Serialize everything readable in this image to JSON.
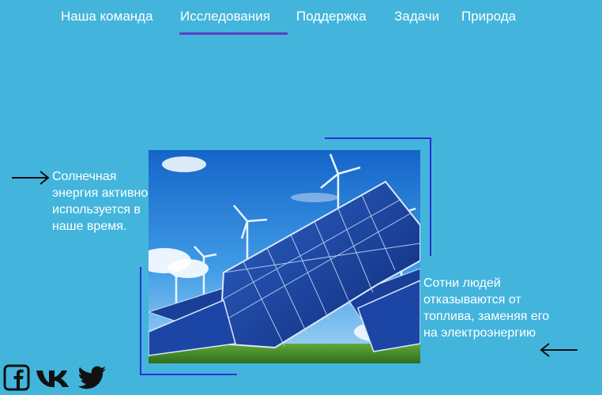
{
  "nav": {
    "items": [
      {
        "label": "Наша команда"
      },
      {
        "label": "Исследования",
        "active": true
      },
      {
        "label": "Поддержка"
      },
      {
        "label": "Задачи"
      },
      {
        "label": "Природа"
      }
    ]
  },
  "captions": {
    "left": "Солнечная энергия активно используется в наше время.",
    "right": "Сотни людей отказываются от топлива, заменяя его на электроэнергию"
  },
  "social": [
    "facebook-icon",
    "vk-icon",
    "twitter-icon"
  ],
  "colors": {
    "background": "#43b5dc",
    "accent_underline": "#5b3ec8",
    "frame_lines": "#2c2fd6",
    "text": "#ffffff"
  }
}
